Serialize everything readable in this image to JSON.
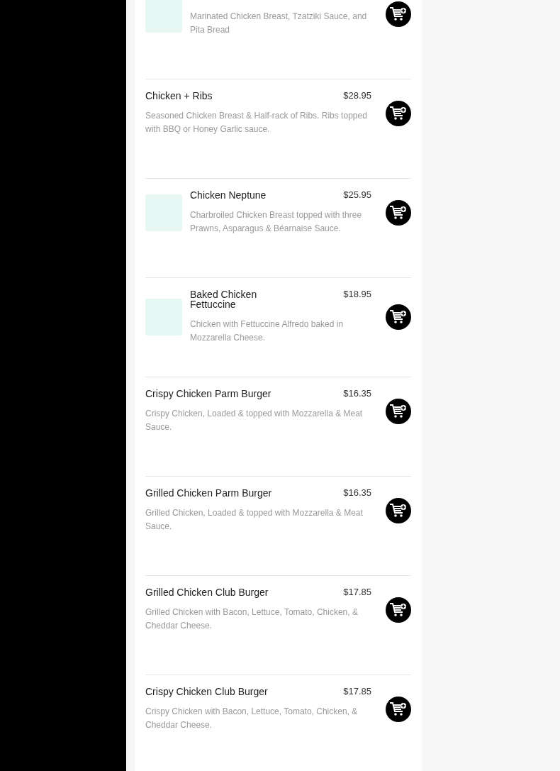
{
  "menu_items": [
    {
      "description": "Marinated Chicken Breast, Tzatziki Sauce, and Pita Bread",
      "has_image": true
    },
    {
      "name": "Chicken + Ribs",
      "price": "$28.95",
      "description": "Seasoned Chicken Breast & Half-rack of Ribs. Ribs topped with BBQ or Honey Garlic sauce.",
      "has_image": false
    },
    {
      "name": "Chicken Neptune",
      "price": "$25.95",
      "description": "Charbroiled Chicken Breast topped with three Prawns, Asparagus & Béarnaise Sauce.",
      "has_image": true
    },
    {
      "name": "Baked Chicken Fettuccine",
      "price": "$18.95",
      "description": "Chicken with Fettuccine Alfredo baked in Mozzarella Cheese.",
      "has_image": true
    },
    {
      "name": "Crispy Chicken Parm Burger",
      "price": "$16.35",
      "description": "Crispy Chicken, Loaded & topped with Mozzarella & Meat Sauce.",
      "has_image": false
    },
    {
      "name": "Grilled Chicken Parm Burger",
      "price": "$16.35",
      "description": "Grilled Chicken, Loaded & topped with Mozzarella & Meat Sauce.",
      "has_image": false
    },
    {
      "name": "Grilled Chicken Club Burger",
      "price": "$17.85",
      "description": "Grilled Chicken with Bacon, Lettuce, Tomato, Chicken, & Cheddar Cheese.",
      "has_image": false
    },
    {
      "name": "Crispy Chicken Club Burger",
      "price": "$17.85",
      "description": "Crispy Chicken with Bacon, Lettuce, Tomato, Chicken, & Cheddar Cheese.",
      "has_image": false
    }
  ]
}
